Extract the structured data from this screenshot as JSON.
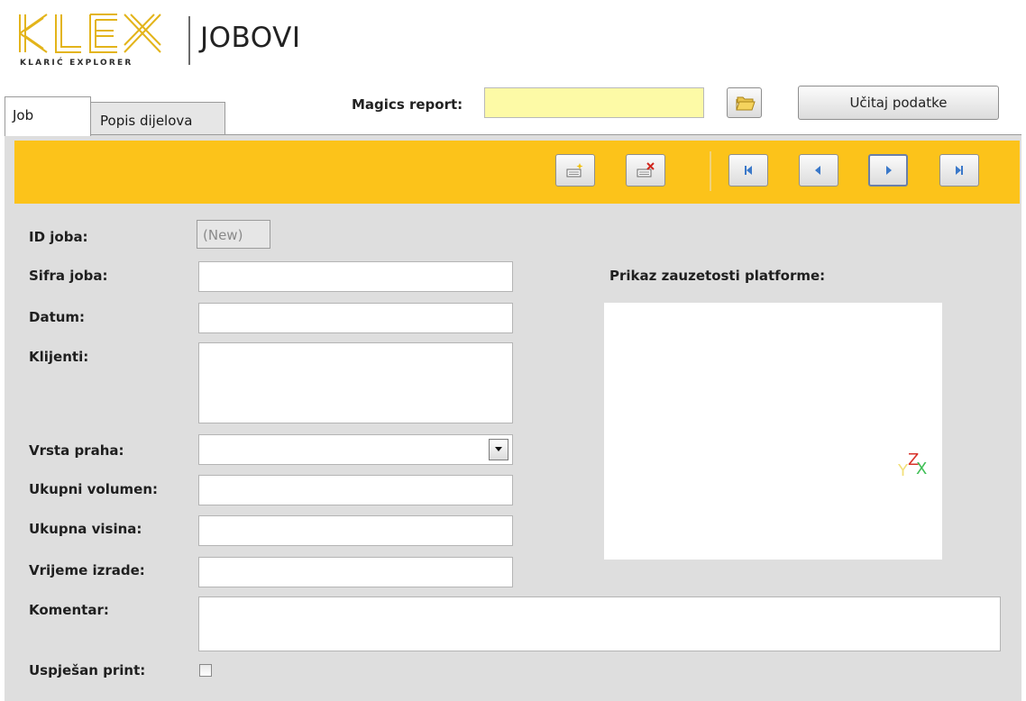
{
  "header": {
    "logo_text": "KLEX",
    "logo_subtitle": "KLARIĆ EXPLORER",
    "title": "JOBOVI"
  },
  "magics": {
    "label": "Magics report:",
    "value": "",
    "folder_icon": "folder-open-icon",
    "load_button": "Učitaj podatke"
  },
  "tabs": [
    {
      "label": "Job",
      "active": true
    },
    {
      "label": "Popis dijelova",
      "active": false
    }
  ],
  "toolbar": {
    "color": "#fcc31a",
    "buttons": [
      {
        "icon": "new-record-icon"
      },
      {
        "icon": "delete-record-icon"
      },
      {
        "icon": "first-record-icon"
      },
      {
        "icon": "previous-record-icon"
      },
      {
        "icon": "next-record-icon"
      },
      {
        "icon": "last-record-icon"
      }
    ]
  },
  "form": {
    "id_label": "ID joba:",
    "id_value": "(New)",
    "sifra_label": "Sifra joba:",
    "datum_label": "Datum:",
    "klijenti_label": "Klijenti:",
    "vrsta_label": "Vrsta praha:",
    "volumen_label": "Ukupni volumen:",
    "visina_label": "Ukupna visina:",
    "vrijeme_label": "Vrijeme izrade:",
    "komentar_label": "Komentar:",
    "uspjesan_label": "Uspješan print:",
    "uspjesan_checked": false
  },
  "platform": {
    "label": "Prikaz zauzetosti platforme:",
    "axis_y": "Y",
    "axis_z": "Z",
    "axis_x": "X"
  }
}
